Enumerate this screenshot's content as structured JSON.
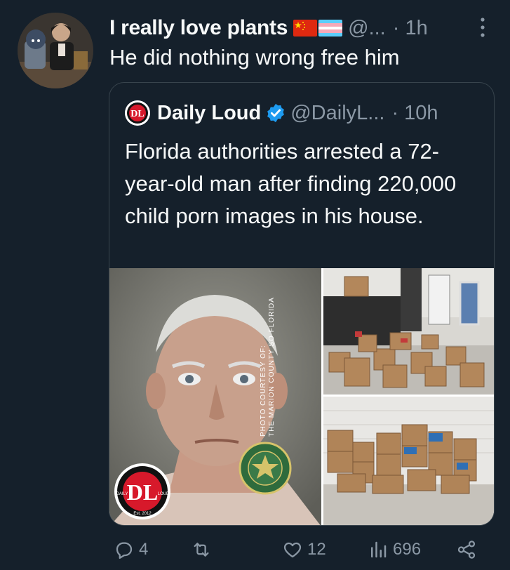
{
  "tweet": {
    "display_name": "I really love plants",
    "handle": "@...",
    "time": "· 1h",
    "text": "He did nothing wrong free him"
  },
  "quote": {
    "display_name": "Daily Loud",
    "handle": "@DailyL...",
    "time": "· 10h",
    "text": "Florida authorities arrested a 72-year-old man after finding 220,000 child porn images in his house.",
    "image": {
      "credit_line1": "PHOTO COURTESY OF:",
      "credit_line2": "THE MARION COUNTY SO FLORIDA",
      "logo_left": "DAILY",
      "logo_right": "LOUD",
      "logo_est": "Est. 2012"
    }
  },
  "actions": {
    "replies": "4",
    "retweets": "",
    "likes": "12",
    "views": "696"
  },
  "colors": {
    "background": "#15202b",
    "secondary_text": "#8b98a5",
    "verified": "#1d9bf0",
    "border": "#38444d"
  },
  "icons": [
    "more-icon",
    "reply-icon",
    "retweet-icon",
    "like-icon",
    "views-icon",
    "share-icon",
    "verified-icon"
  ]
}
